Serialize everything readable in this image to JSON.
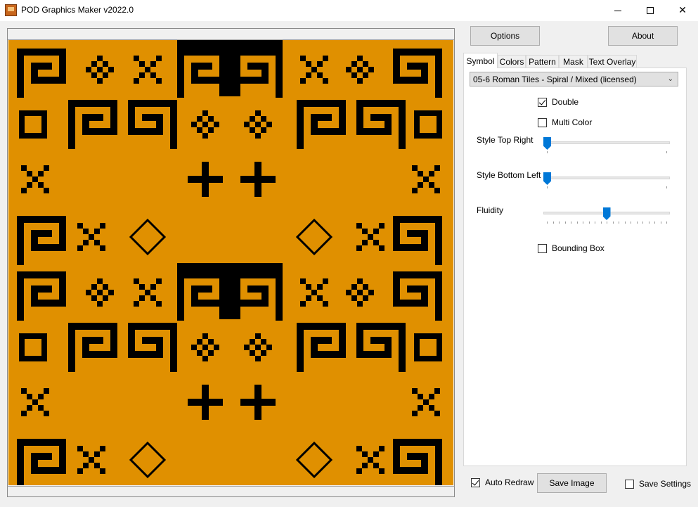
{
  "window": {
    "title": "POD Graphics Maker v2022.0",
    "icon": "app-icon",
    "controls": {
      "minimize": "minimize-icon",
      "maximize": "maximize-icon",
      "close": "close-icon"
    }
  },
  "colors": {
    "pattern_background": "#e09000",
    "pattern_foreground": "#000000",
    "slider_accent": "#0078d7"
  },
  "buttons": {
    "options": "Options",
    "about": "About",
    "save_image": "Save Image"
  },
  "tabs": [
    {
      "label": "Symbol",
      "active": true
    },
    {
      "label": "Colors",
      "active": false
    },
    {
      "label": "Pattern",
      "active": false
    },
    {
      "label": "Mask",
      "active": false
    },
    {
      "label": "Text Overlay",
      "active": false
    }
  ],
  "symbol_panel": {
    "symbol_select": {
      "selected": "05-6 Roman Tiles - Spiral / Mixed (licensed)"
    },
    "double": {
      "label": "Double",
      "checked": true
    },
    "multi_color": {
      "label": "Multi Color",
      "checked": false
    },
    "style_top_right": {
      "label": "Style Top Right",
      "value": 0.0
    },
    "style_bottom_left": {
      "label": "Style Bottom Left",
      "value": 0.0
    },
    "fluidity": {
      "label": "Fluidity",
      "value": 0.5
    },
    "bounding_box": {
      "label": "Bounding Box",
      "checked": false
    }
  },
  "footer": {
    "auto_redraw": {
      "label": "Auto Redraw",
      "checked": true
    },
    "save_settings": {
      "label": "Save Settings",
      "checked": false
    }
  }
}
